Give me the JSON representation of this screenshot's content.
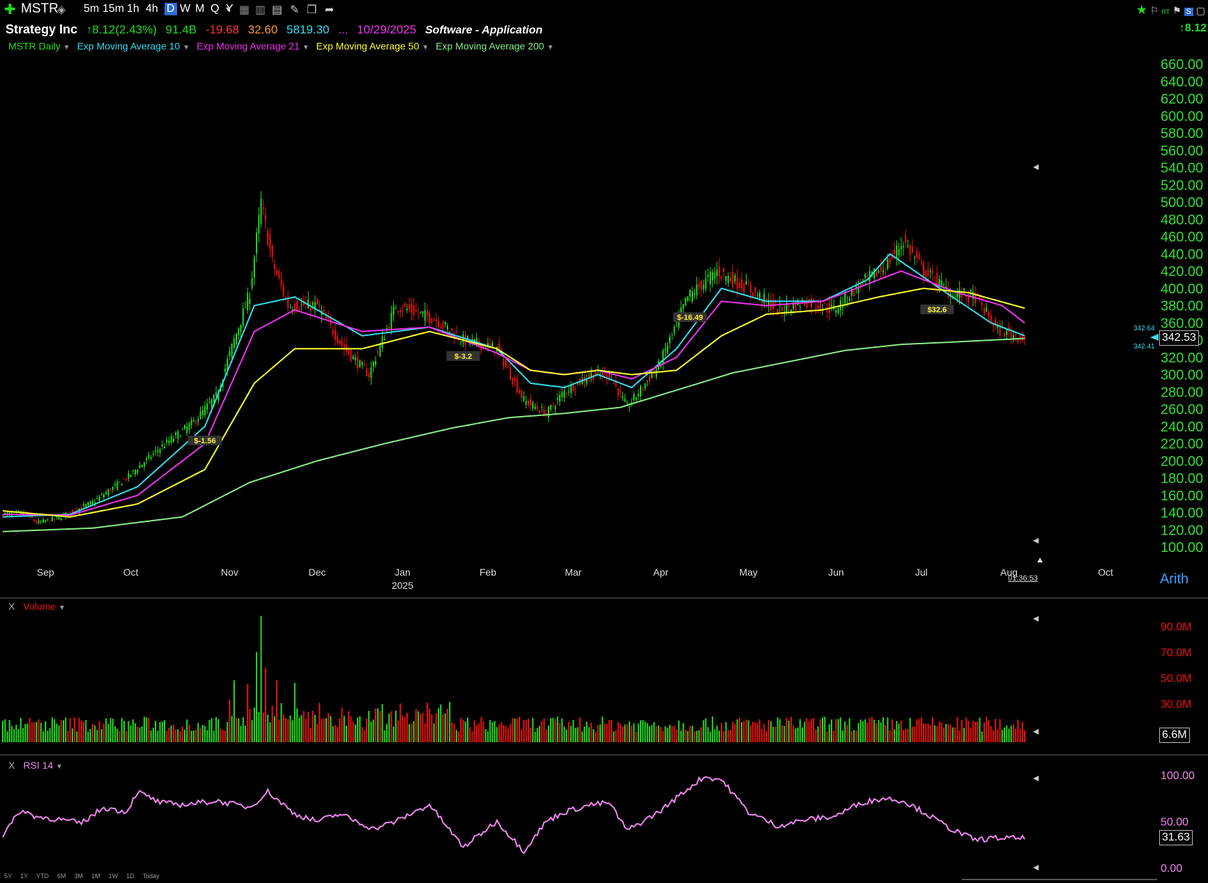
{
  "toolbar": {
    "symbol": "MSTR",
    "intervals": [
      "5m",
      "15m",
      "1h",
      "4h",
      "D",
      "W",
      "M",
      "Q",
      "Y"
    ],
    "active_interval": "D"
  },
  "info": {
    "name": "Strategy Inc",
    "change": "↑8.12(2.43%)",
    "market_cap": "91.4B",
    "eps": "-19.68",
    "pe": "32.60",
    "volume_val": "5819.30",
    "ellipsis": "...",
    "date": "10/29/2025",
    "industry": "Software - Application",
    "right_change": "↑8.12"
  },
  "legend": [
    {
      "label": "MSTR Daily",
      "color": "#22dd22"
    },
    {
      "label": "Exp Moving Average 10",
      "color": "#33ddee"
    },
    {
      "label": "Exp Moving Average 21",
      "color": "#ee33ee"
    },
    {
      "label": "Exp Moving Average 50",
      "color": "#ffff33"
    },
    {
      "label": "Exp Moving Average 200",
      "color": "#88ee88"
    }
  ],
  "colors": {
    "up": "#22dd22",
    "down": "#ee1111",
    "ema10": "#33ddee",
    "ema21": "#ee33ee",
    "ema50": "#ffff33",
    "ema200": "#88ee88",
    "rsi": "#ee88ee",
    "axis_text": "#33dd33"
  },
  "chart_data": [
    {
      "type": "candlestick",
      "title": "MSTR Daily",
      "y_ticks": [
        100,
        120,
        140,
        160,
        180,
        200,
        220,
        240,
        260,
        280,
        300,
        320,
        340,
        360,
        380,
        400,
        420,
        440,
        460,
        480,
        500,
        520,
        540,
        560,
        580,
        600,
        620,
        640,
        660
      ],
      "ylim": [
        100,
        660
      ],
      "x_months": [
        {
          "label": "Sep"
        },
        {
          "label": "Oct"
        },
        {
          "label": "Nov"
        },
        {
          "label": "Dec"
        },
        {
          "label": "Jan",
          "year": "2025"
        },
        {
          "label": "Feb"
        },
        {
          "label": "Mar"
        },
        {
          "label": "Apr"
        },
        {
          "label": "May"
        },
        {
          "label": "Jun"
        },
        {
          "label": "Jul"
        },
        {
          "label": "Aug"
        },
        {
          "label": "Oct"
        }
      ],
      "timestamp": "01:36:53",
      "last_price": "342.53",
      "price_labels": [
        "342.64",
        "342.41"
      ],
      "close_keypoints": [
        [
          0,
          138
        ],
        [
          10,
          140
        ],
        [
          15,
          128
        ],
        [
          25,
          134
        ],
        [
          40,
          152
        ],
        [
          55,
          180
        ],
        [
          70,
          215
        ],
        [
          85,
          245
        ],
        [
          95,
          275
        ],
        [
          103,
          340
        ],
        [
          110,
          395
        ],
        [
          115,
          500
        ],
        [
          120,
          430
        ],
        [
          127,
          380
        ],
        [
          140,
          380
        ],
        [
          152,
          330
        ],
        [
          163,
          300
        ],
        [
          175,
          380
        ],
        [
          192,
          365
        ],
        [
          205,
          340
        ],
        [
          220,
          330
        ],
        [
          232,
          270
        ],
        [
          242,
          255
        ],
        [
          250,
          280
        ],
        [
          262,
          300
        ],
        [
          270,
          300
        ],
        [
          278,
          262
        ],
        [
          292,
          310
        ],
        [
          305,
          390
        ],
        [
          318,
          420
        ],
        [
          332,
          400
        ],
        [
          345,
          375
        ],
        [
          358,
          385
        ],
        [
          370,
          375
        ],
        [
          382,
          405
        ],
        [
          393,
          425
        ],
        [
          401,
          455
        ],
        [
          410,
          420
        ],
        [
          422,
          395
        ],
        [
          433,
          390
        ],
        [
          443,
          352
        ],
        [
          455,
          342
        ]
      ],
      "ema_keypoints": {
        "ema10": [
          [
            0,
            135
          ],
          [
            30,
            138
          ],
          [
            60,
            170
          ],
          [
            90,
            240
          ],
          [
            112,
            380
          ],
          [
            130,
            390
          ],
          [
            160,
            345
          ],
          [
            190,
            355
          ],
          [
            220,
            330
          ],
          [
            235,
            290
          ],
          [
            250,
            285
          ],
          [
            265,
            300
          ],
          [
            280,
            285
          ],
          [
            300,
            330
          ],
          [
            320,
            400
          ],
          [
            340,
            385
          ],
          [
            365,
            385
          ],
          [
            385,
            410
          ],
          [
            395,
            440
          ],
          [
            420,
            395
          ],
          [
            440,
            360
          ],
          [
            455,
            345
          ]
        ],
        "ema21": [
          [
            0,
            138
          ],
          [
            30,
            137
          ],
          [
            60,
            160
          ],
          [
            90,
            220
          ],
          [
            112,
            350
          ],
          [
            130,
            375
          ],
          [
            160,
            350
          ],
          [
            190,
            355
          ],
          [
            220,
            325
          ],
          [
            235,
            305
          ],
          [
            250,
            300
          ],
          [
            265,
            305
          ],
          [
            280,
            295
          ],
          [
            300,
            320
          ],
          [
            320,
            385
          ],
          [
            340,
            380
          ],
          [
            365,
            385
          ],
          [
            385,
            405
          ],
          [
            400,
            420
          ],
          [
            425,
            395
          ],
          [
            445,
            380
          ],
          [
            455,
            360
          ]
        ],
        "ema50": [
          [
            0,
            142
          ],
          [
            30,
            135
          ],
          [
            60,
            150
          ],
          [
            90,
            190
          ],
          [
            112,
            290
          ],
          [
            130,
            330
          ],
          [
            160,
            330
          ],
          [
            190,
            350
          ],
          [
            220,
            330
          ],
          [
            235,
            305
          ],
          [
            250,
            300
          ],
          [
            265,
            305
          ],
          [
            280,
            300
          ],
          [
            300,
            305
          ],
          [
            320,
            345
          ],
          [
            340,
            370
          ],
          [
            365,
            375
          ],
          [
            390,
            390
          ],
          [
            410,
            400
          ],
          [
            430,
            395
          ],
          [
            455,
            377
          ]
        ],
        "ema200": [
          [
            0,
            118
          ],
          [
            40,
            122
          ],
          [
            80,
            135
          ],
          [
            110,
            175
          ],
          [
            140,
            200
          ],
          [
            170,
            220
          ],
          [
            200,
            238
          ],
          [
            225,
            250
          ],
          [
            250,
            255
          ],
          [
            275,
            262
          ],
          [
            300,
            282
          ],
          [
            325,
            302
          ],
          [
            350,
            315
          ],
          [
            375,
            328
          ],
          [
            400,
            335
          ],
          [
            425,
            338
          ],
          [
            455,
            342
          ]
        ]
      },
      "annotations": [
        {
          "text": "$-1.56",
          "at": [
            90,
            222
          ]
        },
        {
          "text": "$-3.2",
          "at": [
            205,
            320
          ]
        },
        {
          "text": "$-16.49",
          "at": [
            306,
            365
          ]
        },
        {
          "text": "$32.6",
          "at": [
            416,
            374
          ]
        }
      ]
    },
    {
      "type": "bar",
      "title": "Volume",
      "y_ticks": [
        "90.0M",
        "70.0M",
        "50.0M",
        "30.0M"
      ],
      "y_tick_values": [
        90,
        70,
        50,
        30
      ],
      "ylim": [
        0,
        100
      ],
      "last_value": "6.6M"
    },
    {
      "type": "line",
      "title": "RSI 14",
      "y_ticks": [
        "100.00",
        "50.00",
        "0.00"
      ],
      "y_tick_values": [
        100,
        50,
        0
      ],
      "ylim": [
        0,
        100
      ],
      "last_value": "31.63",
      "keypoints": [
        [
          0,
          35
        ],
        [
          8,
          62
        ],
        [
          15,
          55
        ],
        [
          25,
          52
        ],
        [
          35,
          48
        ],
        [
          45,
          65
        ],
        [
          55,
          60
        ],
        [
          60,
          82
        ],
        [
          70,
          70
        ],
        [
          80,
          68
        ],
        [
          95,
          72
        ],
        [
          110,
          65
        ],
        [
          118,
          82
        ],
        [
          130,
          58
        ],
        [
          140,
          50
        ],
        [
          150,
          58
        ],
        [
          165,
          42
        ],
        [
          175,
          50
        ],
        [
          190,
          68
        ],
        [
          205,
          22
        ],
        [
          220,
          50
        ],
        [
          232,
          18
        ],
        [
          242,
          50
        ],
        [
          250,
          60
        ],
        [
          262,
          68
        ],
        [
          270,
          70
        ],
        [
          278,
          40
        ],
        [
          292,
          60
        ],
        [
          305,
          85
        ],
        [
          312,
          98
        ],
        [
          320,
          95
        ],
        [
          332,
          60
        ],
        [
          345,
          45
        ],
        [
          358,
          52
        ],
        [
          370,
          55
        ],
        [
          382,
          70
        ],
        [
          393,
          75
        ],
        [
          401,
          72
        ],
        [
          410,
          60
        ],
        [
          422,
          42
        ],
        [
          433,
          30
        ],
        [
          443,
          32
        ],
        [
          455,
          31.6
        ]
      ]
    }
  ],
  "volume_panel": {
    "title": "Volume"
  },
  "rsi_panel": {
    "title": "RSI 14"
  },
  "scale_mode": "Arith",
  "range_buttons": [
    "5Y",
    "1Y",
    "YTD",
    "6M",
    "3M",
    "1M",
    "1W",
    "1D",
    "Today"
  ]
}
